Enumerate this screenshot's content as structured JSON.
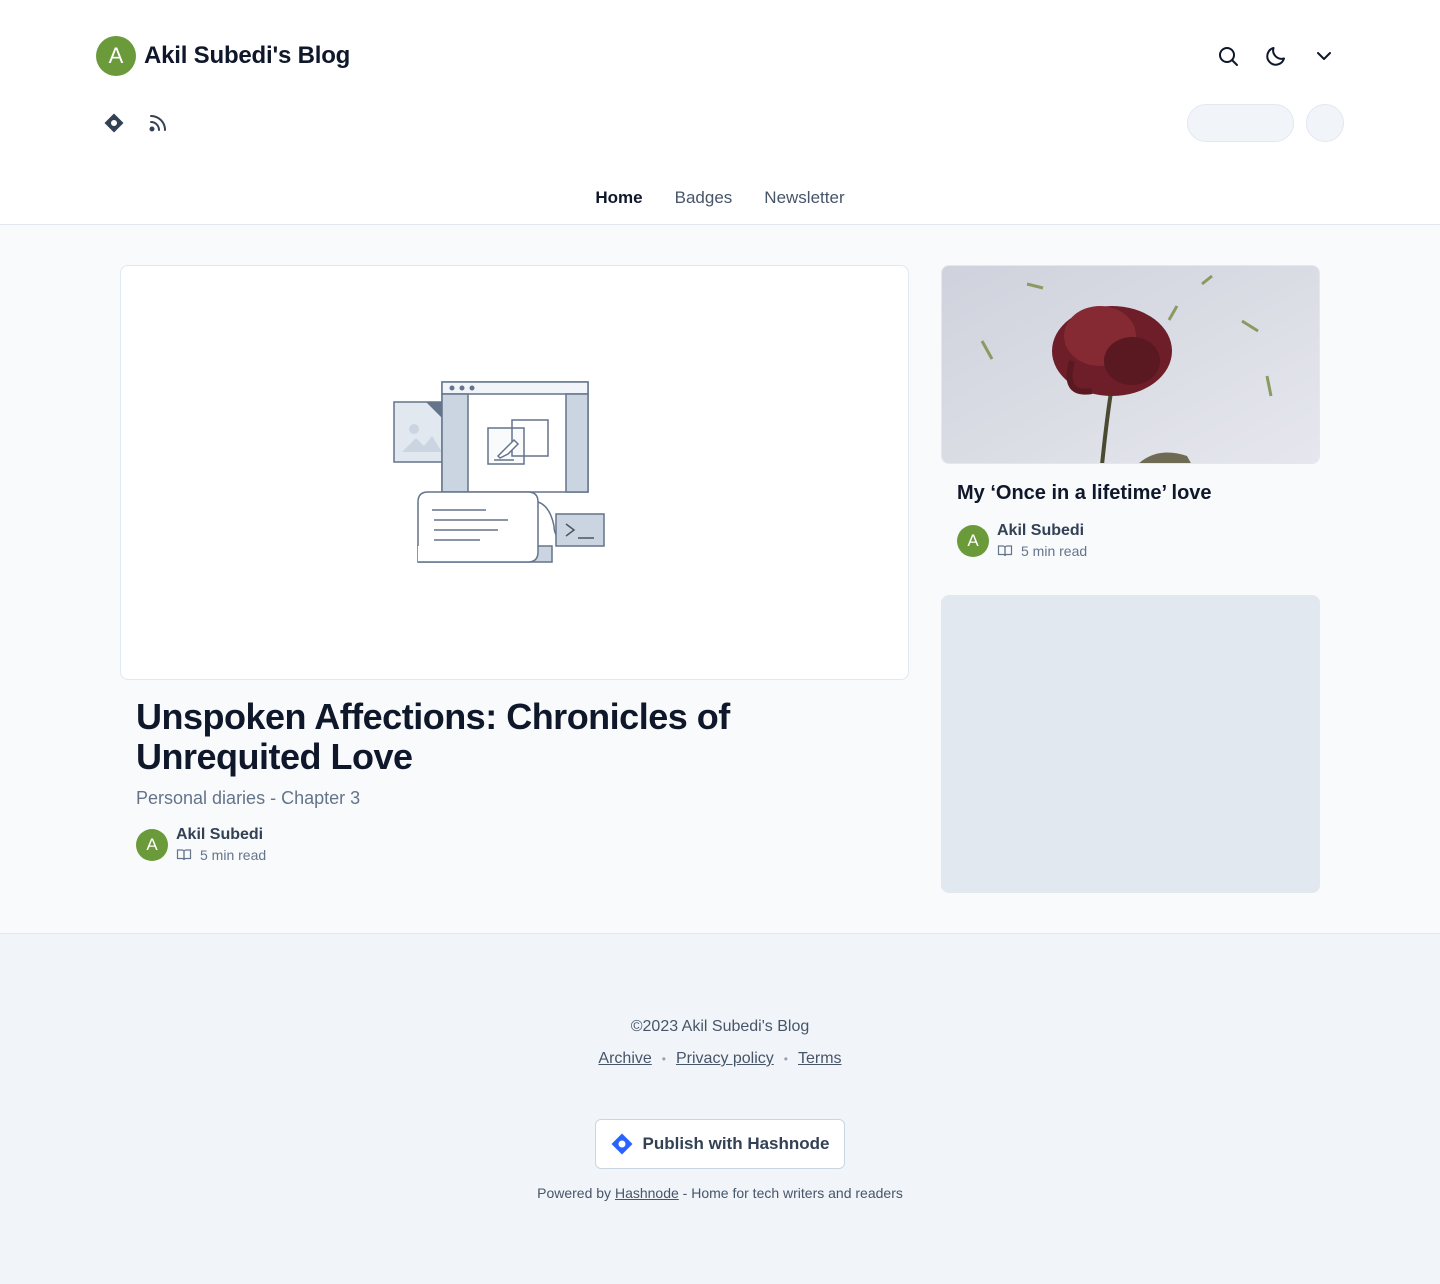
{
  "header": {
    "avatar_letter": "A",
    "blog_title": "Akil Subedi's Blog",
    "icons": [
      "search-icon",
      "moon-icon",
      "chevron-down-icon"
    ],
    "social_icons": [
      "hashnode-icon",
      "rss-icon"
    ]
  },
  "nav": {
    "items": [
      {
        "label": "Home",
        "active": true
      },
      {
        "label": "Badges",
        "active": false
      },
      {
        "label": "Newsletter",
        "active": false
      }
    ]
  },
  "featured": {
    "title": "Unspoken Affections: Chronicles of Unrequited Love",
    "subtitle": "Personal diaries - Chapter 3",
    "author": "Akil Subedi",
    "author_initial": "A",
    "read_time": "5 min read"
  },
  "side_post": {
    "title": "My ‘Once in a lifetime’ love",
    "author": "Akil Subedi",
    "author_initial": "A",
    "read_time": "5 min read"
  },
  "footer": {
    "copyright": "©2023 Akil Subedi's Blog",
    "links": [
      "Archive",
      "Privacy policy",
      "Terms"
    ],
    "publish_label": "Publish with Hashnode",
    "powered_prefix": "Powered by",
    "powered_link": "Hashnode",
    "powered_suffix": "- Home for tech writers and readers"
  },
  "colors": {
    "avatar_green": "#6a9a3a",
    "hashnode_blue": "#2962ff",
    "text_dark": "#0f172a"
  }
}
